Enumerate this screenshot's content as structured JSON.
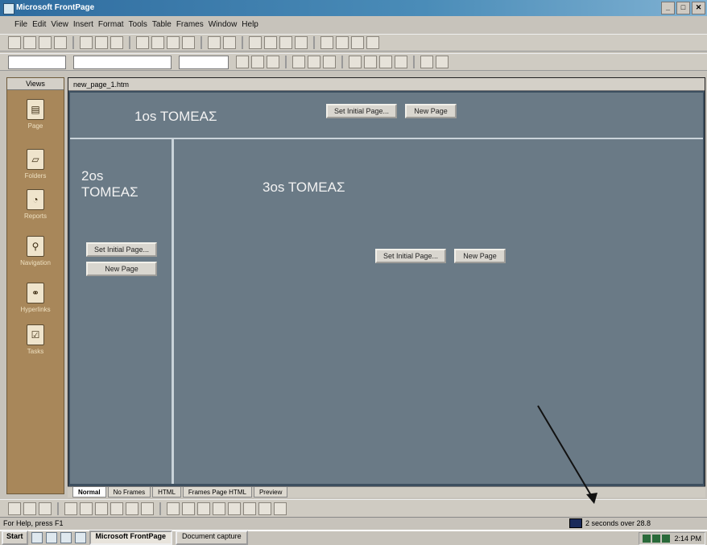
{
  "window": {
    "title": "Microsoft FrontPage",
    "controls": {
      "minimize": "_",
      "maximize": "□",
      "close": "✕"
    }
  },
  "menubar": [
    "File",
    "Edit",
    "View",
    "Insert",
    "Format",
    "Tools",
    "Table",
    "Frames",
    "Window",
    "Help"
  ],
  "views_bar": {
    "header": "Views",
    "items": [
      {
        "label": "Page",
        "icon": "page-view-icon",
        "glyph": "▤"
      },
      {
        "label": "Folders",
        "icon": "folders-view-icon",
        "glyph": "▱"
      },
      {
        "label": "Reports",
        "icon": "reports-view-icon",
        "glyph": "◔"
      },
      {
        "label": "Navigation",
        "icon": "navigation-view-icon",
        "glyph": "⚲"
      },
      {
        "label": "Hyperlinks",
        "icon": "hyperlinks-view-icon",
        "glyph": "⚭"
      },
      {
        "label": "Tasks",
        "icon": "tasks-view-icon",
        "glyph": "☑"
      }
    ]
  },
  "document": {
    "tab_title": "new_page_1.htm",
    "frames": {
      "top": {
        "title": "1os TOMEAΣ",
        "buttons": [
          "Set Initial Page...",
          "New Page"
        ]
      },
      "left": {
        "title_line1": "2os",
        "title_line2": "TOMEAΣ",
        "buttons": [
          "Set Initial Page...",
          "New Page"
        ]
      },
      "main": {
        "title": "3os TOMEAΣ",
        "buttons": [
          "Set Initial Page...",
          "New Page"
        ]
      }
    }
  },
  "view_tabs": [
    "Normal",
    "No Frames",
    "HTML",
    "Frames Page HTML",
    "Preview"
  ],
  "status": {
    "left": "For Help, press F1",
    "right": "2 seconds over 28.8"
  },
  "taskbar": {
    "start": "Start",
    "tasks": [
      "Microsoft FrontPage",
      "Document capture"
    ],
    "clock": "2:14 PM"
  },
  "colors": {
    "frame_bg": "#6a7a86",
    "views_bar_bg": "#a8875a",
    "titlebar_start": "#2f6c9f"
  }
}
